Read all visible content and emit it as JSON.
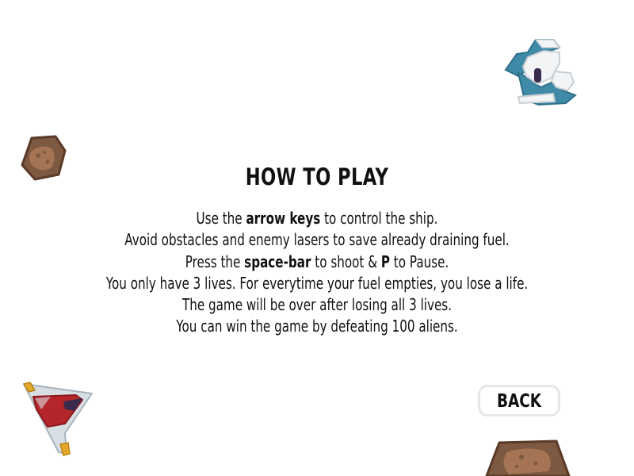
{
  "screen": {
    "title": "HOW TO PLAY",
    "instructions": [
      {
        "before": "Use the ",
        "bold": "arrow keys",
        "after": " to control the ship."
      },
      {
        "before": "Avoid obstacles and enemy lasers to save already draining fuel.",
        "bold": "",
        "after": ""
      },
      {
        "before": "Press the ",
        "bold": "space-bar",
        "after": " to shoot & ",
        "bold2": "P",
        "after2": " to Pause."
      },
      {
        "before": "You only have 3 lives. For everytime your fuel empties, you lose a life.",
        "bold": "",
        "after": ""
      },
      {
        "before": "The game will be over after losing all 3 lives.",
        "bold": "",
        "after": ""
      },
      {
        "before": "You can win the game by defeating 100 aliens.",
        "bold": "",
        "after": ""
      }
    ],
    "back_label": "BACK"
  },
  "colors": {
    "background": "#ffffff",
    "text": "#111111",
    "button_border": "#e7e7e3",
    "asteroid": "#7d5941",
    "asteroid_dark": "#5a3a28",
    "asteroid_spot": "#a57454",
    "enemy_ship": "#3f8aa6",
    "enemy_ship_dark": "#2c6f8a",
    "player_ship_red": "#b5262a",
    "player_ship_wing": "#d8dfe4",
    "player_ship_gold": "#e2a82a"
  },
  "icons": {
    "enemy": "enemy-ship-icon",
    "asteroid": "asteroid-icon",
    "player": "player-ship-icon"
  }
}
